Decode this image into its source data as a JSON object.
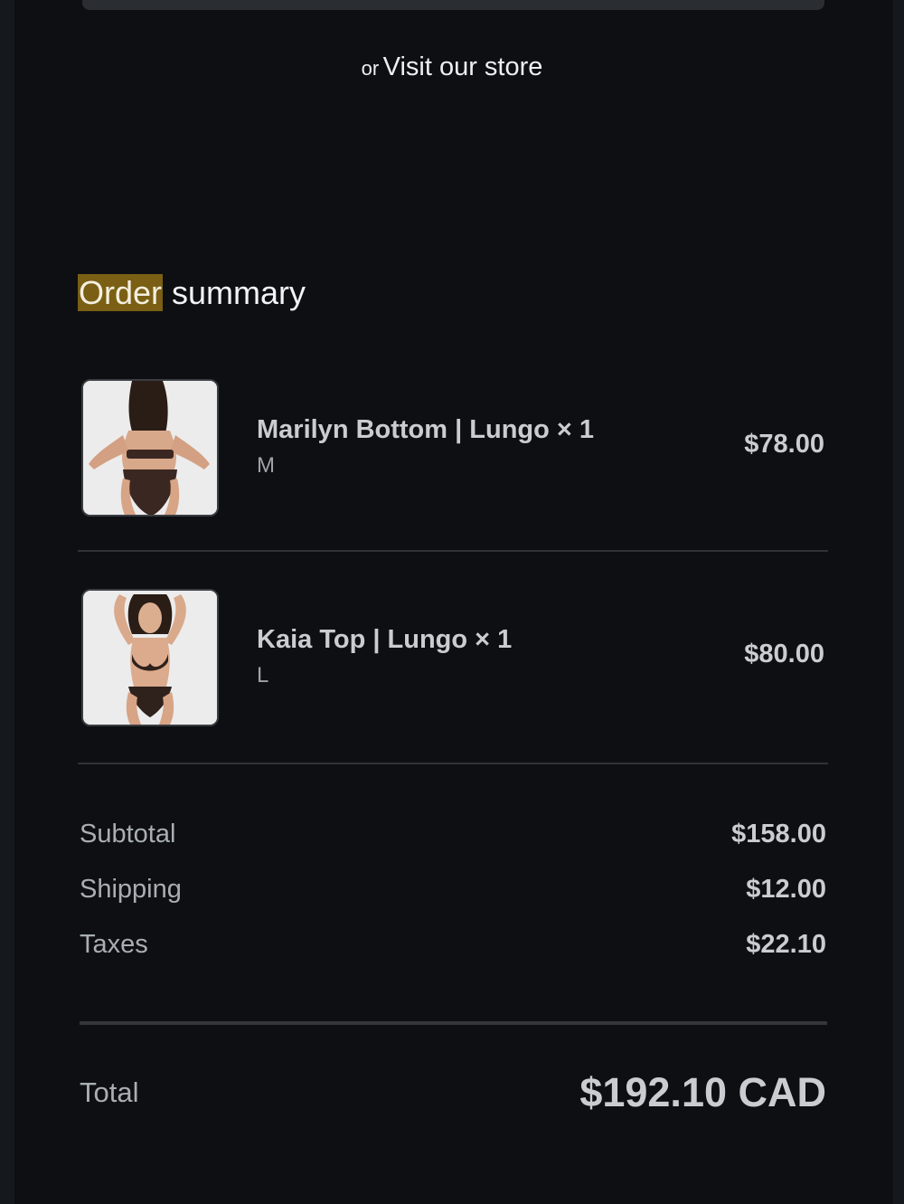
{
  "header": {
    "or_text": "or",
    "visit_store_link": "Visit our store"
  },
  "summary": {
    "title_highlight": "Order",
    "title_rest": " summary"
  },
  "items": [
    {
      "name": "Marilyn Bottom | Lungo × 1",
      "variant": "M",
      "price": "$78.00",
      "image": "swimwear-bottom-back-view-photo"
    },
    {
      "name": "Kaia Top | Lungo × 1",
      "variant": "L",
      "price": "$80.00",
      "image": "swimwear-set-front-view-photo"
    }
  ],
  "totals": {
    "subtotal_label": "Subtotal",
    "subtotal_value": "$158.00",
    "shipping_label": "Shipping",
    "shipping_value": "$12.00",
    "taxes_label": "Taxes",
    "taxes_value": "$22.10",
    "total_label": "Total",
    "total_value": "$192.10 CAD"
  },
  "colors": {
    "background": "#0d0f12",
    "highlight": "#7a5f14",
    "text_primary": "#c9cdd2",
    "text_muted": "#a9aeb4"
  }
}
